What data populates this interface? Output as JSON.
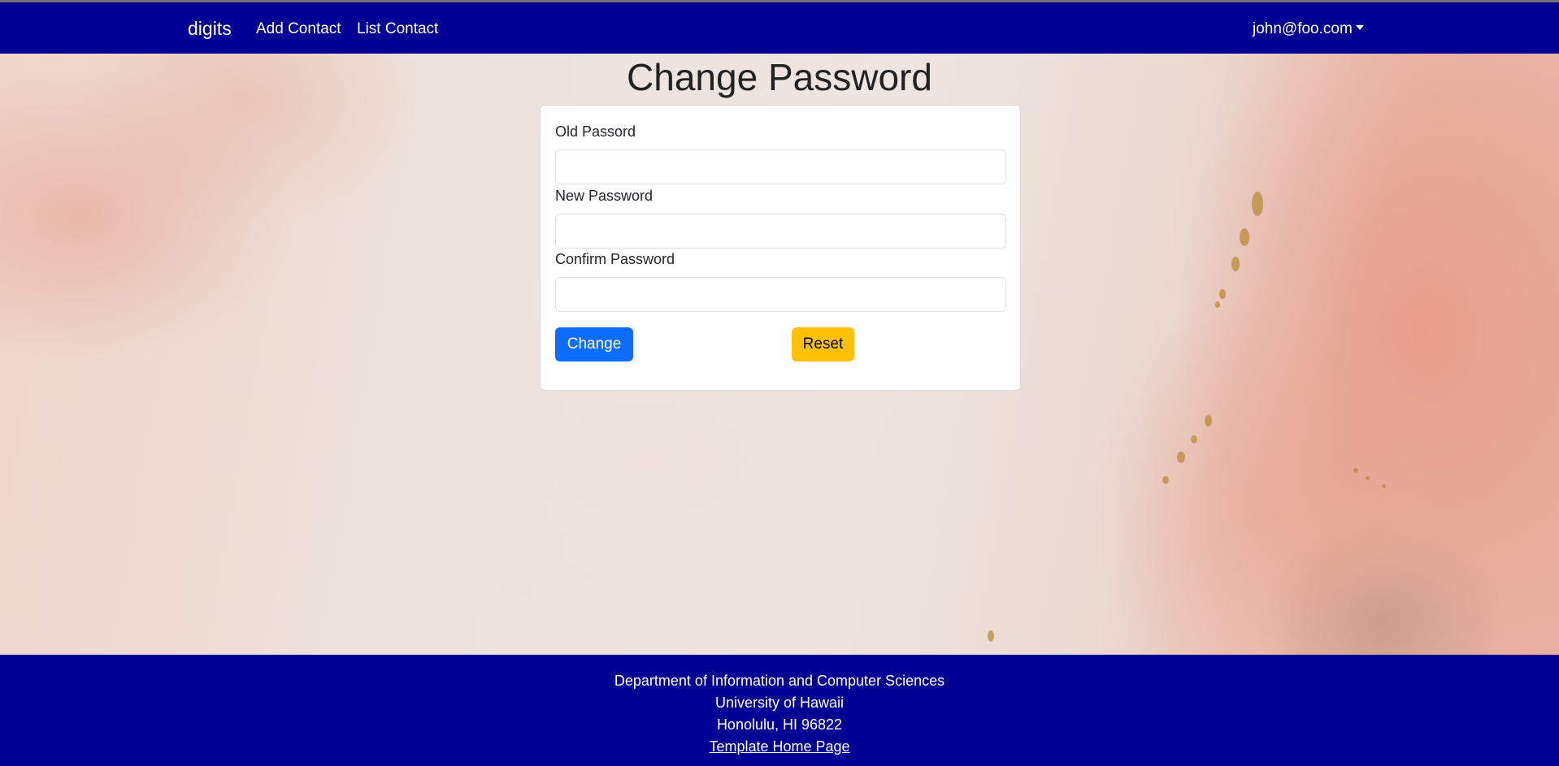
{
  "navbar": {
    "brand": "digits",
    "links": [
      "Add Contact",
      "List Contact"
    ],
    "user": "john@foo.com"
  },
  "page": {
    "title": "Change Password"
  },
  "form": {
    "fields": [
      {
        "label": "Old Passord",
        "value": ""
      },
      {
        "label": "New Password",
        "value": ""
      },
      {
        "label": "Confirm Password",
        "value": ""
      }
    ],
    "change_label": "Change",
    "reset_label": "Reset"
  },
  "footer": {
    "lines": [
      "Department of Information and Computer Sciences",
      "University of Hawaii",
      "Honolulu, HI 96822"
    ],
    "link": "Template Home Page"
  },
  "colors": {
    "navbar": "#000093",
    "primary": "#0d6efd",
    "warning": "#ffc107"
  }
}
